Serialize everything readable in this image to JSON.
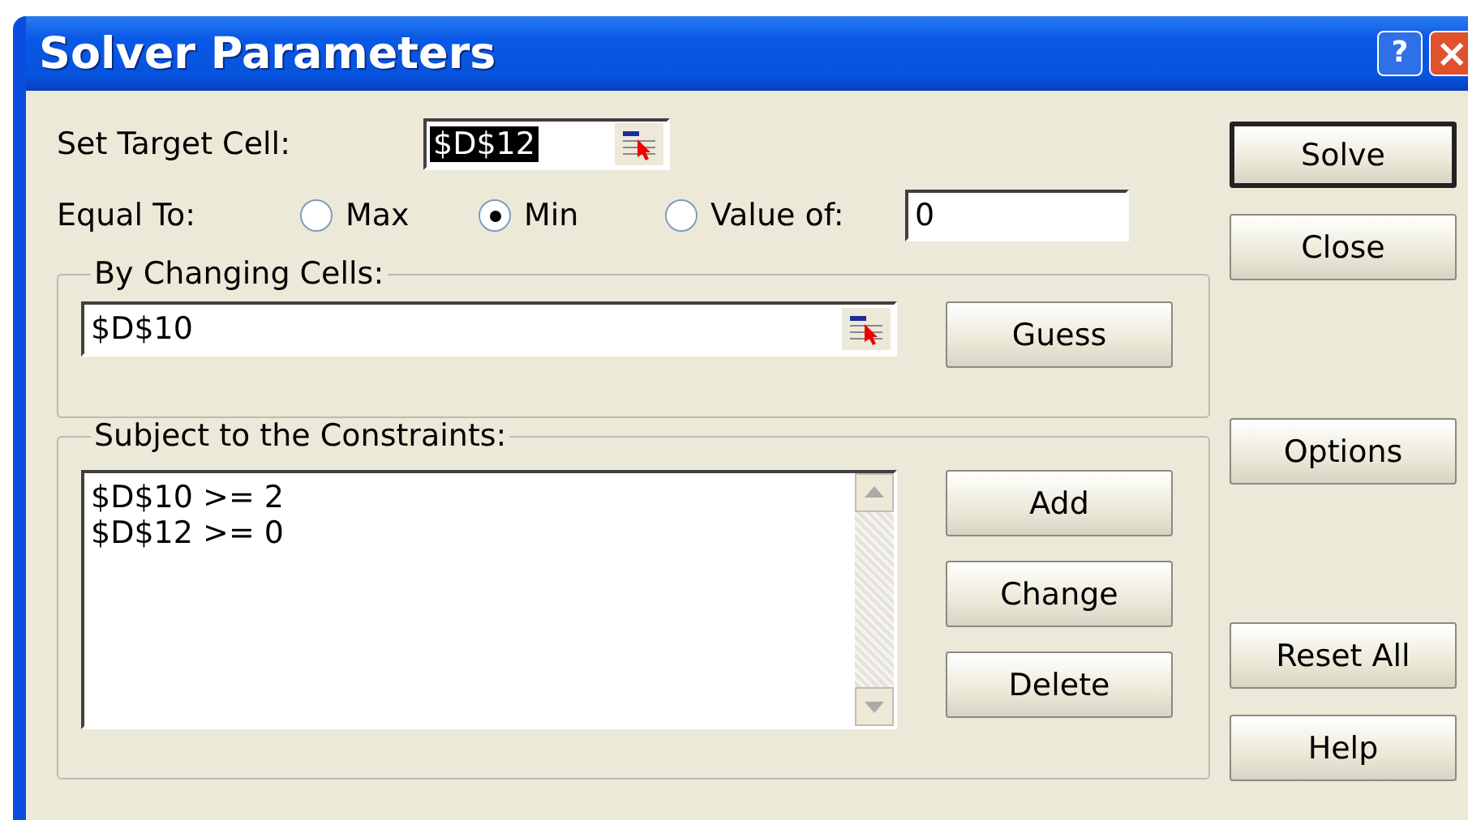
{
  "window": {
    "title": "Solver Parameters",
    "buttons": [
      {
        "kind": "help",
        "label": "?"
      },
      {
        "kind": "close",
        "label": "×"
      }
    ]
  },
  "target": {
    "label": "Set Target Cell:",
    "value": "$D$12",
    "value_selected": true
  },
  "equal_to": {
    "label": "Equal To:",
    "options": [
      {
        "label": "Max",
        "selected": false
      },
      {
        "label": "Min",
        "selected": true
      },
      {
        "label": "Value of:",
        "selected": false
      }
    ],
    "value": "0"
  },
  "changing_cells": {
    "label": "By Changing Cells:",
    "value": "$D$10",
    "button": "Guess"
  },
  "constraints": {
    "label": "Subject to the Constraints:",
    "items": [
      "$D$10 >= 2",
      "$D$12 >= 0"
    ],
    "buttons": [
      "Add",
      "Change",
      "Delete"
    ]
  },
  "side_button_groups": [
    [
      {
        "label": "Solve",
        "default": true
      },
      {
        "label": "Close",
        "default": false
      }
    ],
    [
      {
        "label": "Options",
        "default": false
      }
    ],
    [
      {
        "label": "Reset All",
        "default": false
      },
      {
        "label": "Help",
        "default": false
      }
    ]
  ]
}
